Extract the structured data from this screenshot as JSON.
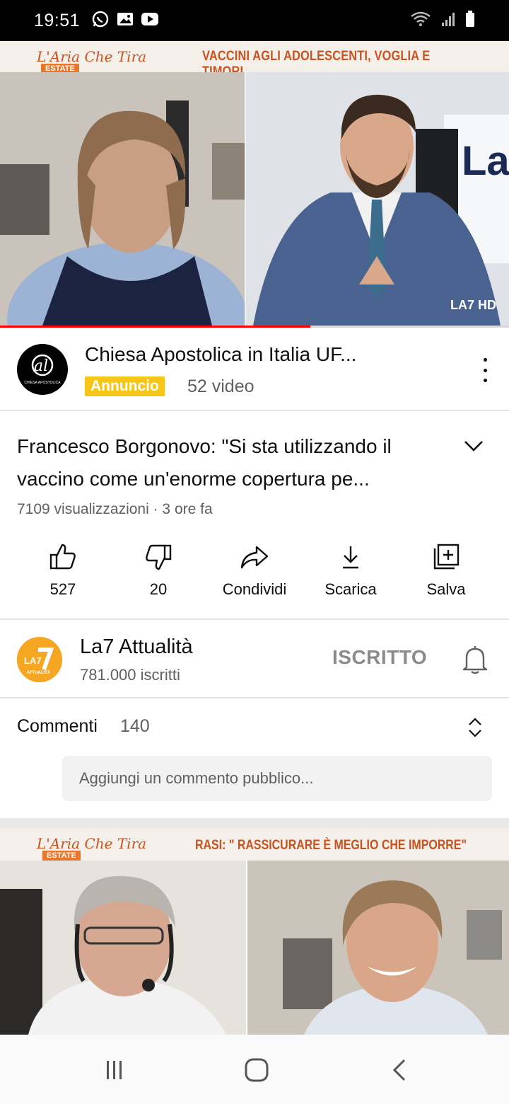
{
  "status_bar": {
    "time": "19:51",
    "notification_icons": [
      "whatsapp-icon",
      "image-icon",
      "youtube-icon"
    ],
    "system_icons": [
      "wifi-icon",
      "signal-icon",
      "battery-icon"
    ]
  },
  "player": {
    "banner_logo": "L'Aria Che Tira",
    "banner_logo_badge": "ESTATE",
    "banner_headline": "VACCINI AGLI ADOLESCENTI, VOGLIA E TIMORI",
    "channel_bug": "LA7 HD",
    "progress": 0.61,
    "progress_color": "#ff0000"
  },
  "ad": {
    "title": "Chiesa Apostolica in Italia UF...",
    "badge": "Annuncio",
    "badge_color": "#f5c518",
    "meta": "52 video",
    "avatar_text": "CHIESA APOSTOLICA"
  },
  "video": {
    "title": "Francesco Borgonovo: \"Si sta utilizzando il vaccino come un'enorme copertura pe...",
    "meta": "7109 visualizzazioni · 3 ore fa"
  },
  "actions": [
    {
      "icon": "thumbs-up-icon",
      "label": "527"
    },
    {
      "icon": "thumbs-down-icon",
      "label": "20"
    },
    {
      "icon": "share-icon",
      "label": "Condividi"
    },
    {
      "icon": "download-icon",
      "label": "Scarica"
    },
    {
      "icon": "save-playlist-icon",
      "label": "Salva"
    }
  ],
  "channel": {
    "name": "La7 Attualità",
    "subscribers": "781.000 iscritti",
    "subscribe_state": "ISCRITTO",
    "avatar_text": "LA7",
    "avatar_sub": "ATTUALITÀ",
    "accent": "#f5a623"
  },
  "comments": {
    "label": "Commenti",
    "count": "140",
    "placeholder": "Aggiungi un commento pubblico..."
  },
  "next_video": {
    "banner_logo": "L'Aria Che Tira",
    "banner_logo_badge": "ESTATE",
    "banner_headline": "RASI: \" RASSICURARE È MEGLIO CHE IMPORRE\""
  },
  "navbar": {
    "buttons": [
      "recent-apps-icon",
      "home-icon",
      "back-icon"
    ]
  }
}
